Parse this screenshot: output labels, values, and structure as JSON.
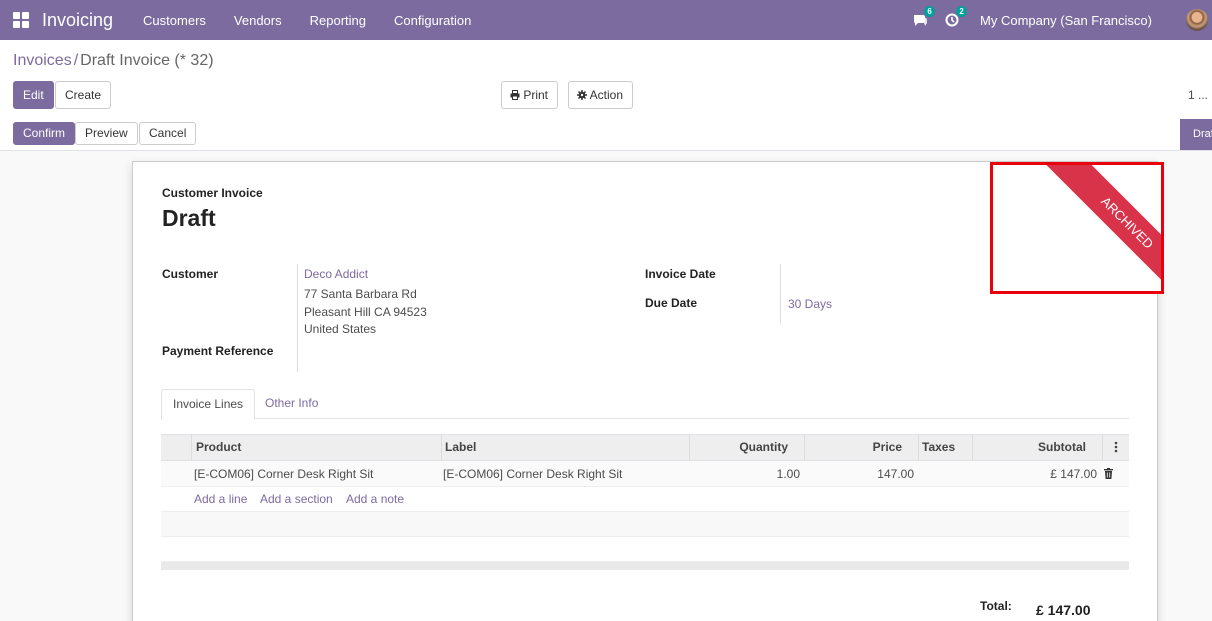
{
  "app": {
    "title": "Invoicing"
  },
  "nav": {
    "items": [
      {
        "label": "Customers"
      },
      {
        "label": "Vendors"
      },
      {
        "label": "Reporting"
      },
      {
        "label": "Configuration"
      }
    ],
    "messages_count": "6",
    "activities_count": "2",
    "company": "My Company (San Francisco)"
  },
  "breadcrumb": {
    "parent": "Invoices",
    "separator": "/",
    "current": "Draft Invoice (* 32)"
  },
  "buttons": {
    "edit": "Edit",
    "create": "Create",
    "print": "Print",
    "action": "Action",
    "confirm": "Confirm",
    "preview": "Preview",
    "cancel": "Cancel"
  },
  "pager": {
    "value": "1 ..."
  },
  "status": {
    "current": "Draft"
  },
  "ribbon": {
    "label": "ARCHIVED",
    "color": "#d9334a"
  },
  "form": {
    "doc_type": "Customer Invoice",
    "doc_name": "Draft",
    "customer_label": "Customer",
    "customer": {
      "name": "Deco Addict",
      "street": "77 Santa Barbara Rd",
      "city": "Pleasant Hill CA 94523",
      "country": "United States"
    },
    "payment_reference_label": "Payment Reference",
    "invoice_date_label": "Invoice Date",
    "due_date_label": "Due Date",
    "due_date_value": "30 Days"
  },
  "tabs": [
    {
      "label": "Invoice Lines"
    },
    {
      "label": "Other Info"
    }
  ],
  "lines": {
    "columns": {
      "product": "Product",
      "label": "Label",
      "quantity": "Quantity",
      "price": "Price",
      "taxes": "Taxes",
      "subtotal": "Subtotal"
    },
    "rows": [
      {
        "product": "[E-COM06] Corner Desk Right Sit",
        "label": "[E-COM06] Corner Desk Right Sit",
        "quantity": "1.00",
        "price": "147.00",
        "taxes": "",
        "subtotal": "£ 147.00"
      }
    ],
    "add_line": "Add a line",
    "add_section": "Add a section",
    "add_note": "Add a note"
  },
  "totals": {
    "label": "Total:",
    "value": "£ 147.00"
  },
  "colors": {
    "brand": "#7c6b9f",
    "badge": "#00a09d",
    "highlight": "#e8000c"
  }
}
